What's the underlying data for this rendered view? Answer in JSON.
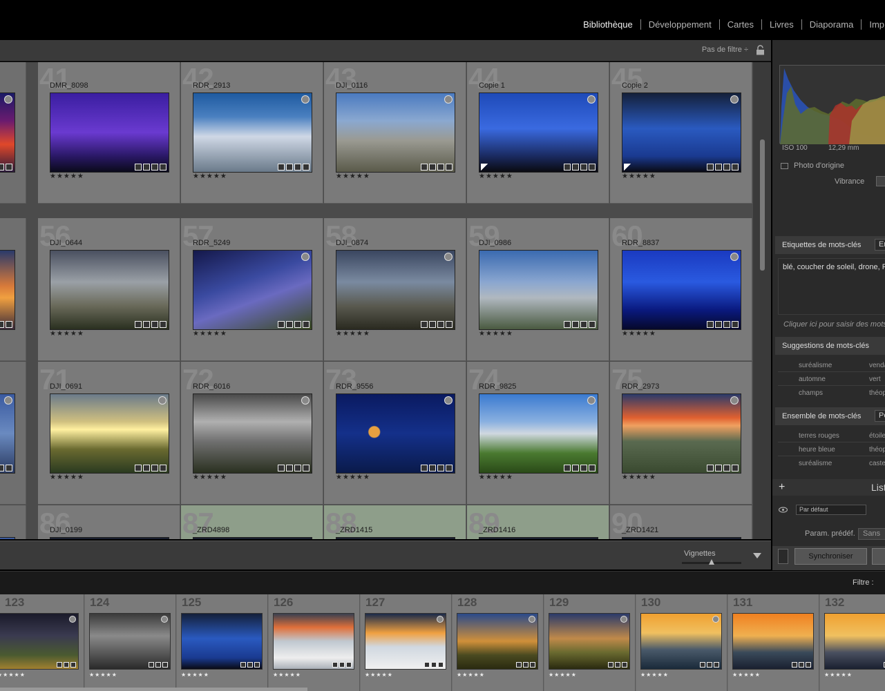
{
  "modules": [
    {
      "label": "Bibliothèque",
      "active": true
    },
    {
      "label": "Développement",
      "active": false
    },
    {
      "label": "Cartes",
      "active": false
    },
    {
      "label": "Livres",
      "active": false
    },
    {
      "label": "Diaporama",
      "active": false
    },
    {
      "label": "Imp",
      "active": false
    }
  ],
  "filterbar": {
    "label": "Pas de filtre ÷"
  },
  "grid": {
    "rows": [
      [
        {
          "num": "",
          "name": "",
          "stars": "",
          "thumb": "sunset1",
          "dot": true,
          "partial": true
        },
        {
          "num": "41",
          "name": "DMR_8098",
          "stars": "★★★★★",
          "thumb": "tree",
          "dot": false
        },
        {
          "num": "42",
          "name": "RDR_2913",
          "stars": "★★★★★",
          "thumb": "snow",
          "dot": true
        },
        {
          "num": "43",
          "name": "DJI_0116",
          "stars": "★★★★★",
          "thumb": "ridge",
          "dot": true
        },
        {
          "num": "44",
          "name": "Copie 1",
          "stars": "★★★★★",
          "thumb": "lightning",
          "dot": true,
          "flag": true
        },
        {
          "num": "45",
          "name": "Copie 2",
          "stars": "★★★★★",
          "thumb": "lightning2",
          "dot": true,
          "flag": true
        }
      ],
      [
        {
          "num": "",
          "name": "",
          "stars": "",
          "thumb": "sunset2",
          "dot": false,
          "partial": true
        },
        {
          "num": "56",
          "name": "DJI_0644",
          "stars": "★★★★★",
          "thumb": "fog",
          "dot": false
        },
        {
          "num": "57",
          "name": "RDR_5249",
          "stars": "★★★★★",
          "thumb": "stars",
          "dot": true
        },
        {
          "num": "58",
          "name": "DJI_0874",
          "stars": "★★★★★",
          "thumb": "ruins",
          "dot": true
        },
        {
          "num": "59",
          "name": "DJI_0986",
          "stars": "★★★★★",
          "thumb": "mist",
          "dot": false
        },
        {
          "num": "60",
          "name": "RDR_8837",
          "stars": "★★★★★",
          "thumb": "bluenight",
          "dot": true
        }
      ],
      [
        {
          "num": "",
          "name": "",
          "stars": "",
          "thumb": "blue",
          "dot": true,
          "partial": true
        },
        {
          "num": "71",
          "name": "DJI_0691",
          "stars": "★★★★★",
          "thumb": "sunrise",
          "dot": true
        },
        {
          "num": "72",
          "name": "RDR_6016",
          "stars": "★★★★★",
          "thumb": "vines",
          "dot": true
        },
        {
          "num": "73",
          "name": "RDR_9556",
          "stars": "★★★★★",
          "thumb": "moon",
          "dot": true
        },
        {
          "num": "74",
          "name": "RDR_9825",
          "stars": "★★★★★",
          "thumb": "green",
          "dot": true
        },
        {
          "num": "75",
          "name": "RDR_2973",
          "stars": "★★★★★",
          "thumb": "cairn",
          "dot": true
        }
      ],
      [
        {
          "num": "",
          "name": "",
          "stars": "",
          "thumb": "blue",
          "dot": false,
          "partial": true
        },
        {
          "num": "86",
          "name": "DJI_0199",
          "stars": "",
          "thumb": "dark",
          "dot": false
        },
        {
          "num": "87",
          "name": "_ZRD4898",
          "stars": "",
          "thumb": "dark",
          "dot": true,
          "sel": true
        },
        {
          "num": "88",
          "name": "_ZRD1415",
          "stars": "",
          "thumb": "dark",
          "dot": false,
          "sel": true
        },
        {
          "num": "89",
          "name": "_ZRD1416",
          "stars": "",
          "thumb": "dark",
          "dot": true,
          "sel": true
        },
        {
          "num": "90",
          "name": "_ZRD1421",
          "stars": "",
          "thumb": "dark",
          "dot": false
        }
      ]
    ]
  },
  "toolbar": {
    "vignettes": "Vignettes"
  },
  "rightpanel": {
    "iso": "ISO 100",
    "focal": "12,29 mm",
    "photo_origine": "Photo d'origine",
    "vibrance": "Vibrance",
    "kw_tags_header": "Etiquettes de mots-clés",
    "kw_tags_drop": "En",
    "kw_tags_text": "blé, coucher de soleil, drone, Pi",
    "kw_placeholder": "Cliquer ici pour saisir des mots-",
    "kw_suggest_header": "Suggestions de mots-clés",
    "kw_suggestions": [
      "suréalisme",
      "vendange",
      "automne",
      "vert",
      "champs",
      "théophile qui"
    ],
    "kw_set_header": "Ensemble de mots-clés",
    "kw_set_drop": "Pe",
    "kw_set": [
      "terres rouges",
      "étoiles",
      "heure bleue",
      "théophile qui",
      "suréalisme",
      "castelnau le"
    ],
    "list_label": "List",
    "par_defaut": "Par défaut",
    "param_label": "Param. prédéf.",
    "param_drop": "Sans",
    "sync_label": "Synchroniser"
  },
  "filmbar": {
    "filter_label": "Filtre :"
  },
  "filmstrip": [
    {
      "num": "123",
      "thumb": "storm",
      "stars": "★★★★★",
      "dot": true
    },
    {
      "num": "124",
      "thumb": "grey",
      "stars": "★★★★★",
      "dot": true
    },
    {
      "num": "125",
      "thumb": "lightning2",
      "stars": "★★★★★",
      "dot": false
    },
    {
      "num": "126",
      "thumb": "clouds",
      "stars": "★★★★★",
      "dot": false
    },
    {
      "num": "127",
      "thumb": "cloudsun",
      "stars": "★★★★★",
      "dot": true
    },
    {
      "num": "128",
      "thumb": "horse",
      "stars": "★★★★★",
      "dot": true
    },
    {
      "num": "129",
      "thumb": "horse2",
      "stars": "★★★★★",
      "dot": true
    },
    {
      "num": "130",
      "thumb": "orange",
      "stars": "★★★★★",
      "dot": true
    },
    {
      "num": "131",
      "thumb": "orange2",
      "stars": "★★★★★",
      "dot": false
    },
    {
      "num": "132",
      "thumb": "orange3",
      "stars": "★★★★★",
      "dot": false
    }
  ],
  "colors": {
    "background": "#000000",
    "grid_cell": "#7a7a7a",
    "grid_cell_selected": "#8e9e8a",
    "panel": "#2b2b2b",
    "active_module": "#f0f0f0"
  }
}
